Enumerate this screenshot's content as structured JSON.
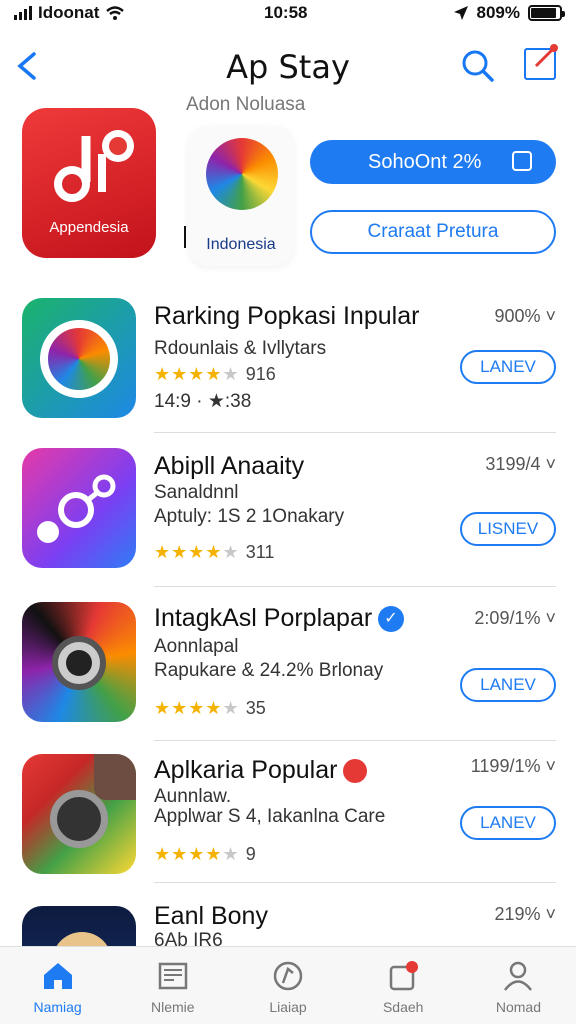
{
  "status": {
    "carrier": "Idoonat",
    "time": "10:58",
    "battery": "809%"
  },
  "nav": {
    "title": "Ap Stay",
    "subtitle": "Adon Noluasa"
  },
  "hero": {
    "app1_label": "Appendesia",
    "app2_label": "Indonesia",
    "primary_button": "SohoOnt 2%",
    "secondary_button": "Craraat Pretura"
  },
  "apps": [
    {
      "title": "Rarking Popkasi Inpular",
      "line1": "Rdounlais & Ivllytars",
      "rating_count": "916",
      "line3": "14:9 · ★:38",
      "meta": "900%",
      "button": "LANEV"
    },
    {
      "title": "Abipll Anaaity",
      "line1": "Sanaldnnl",
      "line2": "Aptuly: 1S 2 1Onakary",
      "rating_count": "311",
      "meta": "3199/4",
      "button": "LISNEV"
    },
    {
      "title": "IntagkAsl Porplapar",
      "line1": "Aonnlapal",
      "line2": "Rapukare & 24.2% Brlonay",
      "rating_count": "35",
      "meta": "2:09/1%",
      "button": "LANEV"
    },
    {
      "title": "Aplkaria Popular",
      "line1": "Aunnlaw.",
      "line2": "Applwar S 4, Iakanlna Care",
      "rating_count": "9",
      "meta": "1199/1%",
      "button": "LANEV"
    },
    {
      "title": "Eanl Bony",
      "line1": "6Ab IR6",
      "meta": "219%"
    }
  ],
  "tabs": [
    {
      "label": "Namiag",
      "icon": "home-icon"
    },
    {
      "label": "Nlemie",
      "icon": "news-icon"
    },
    {
      "label": "Liaiap",
      "icon": "compass-icon"
    },
    {
      "label": "Sdaeh",
      "icon": "updates-icon"
    },
    {
      "label": "Nomad",
      "icon": "profile-icon"
    }
  ],
  "colors": {
    "accent": "#1e7bf2",
    "star": "#f5b301",
    "badge": "#e53935"
  }
}
